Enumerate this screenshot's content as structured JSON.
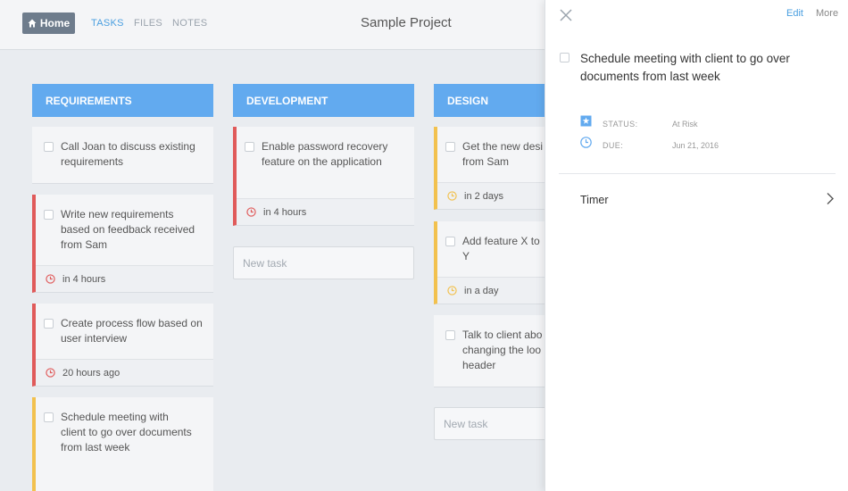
{
  "header": {
    "home_label": "Home",
    "tabs": [
      "TASKS",
      "FILES",
      "NOTES"
    ],
    "project_title": "Sample Project"
  },
  "columns": [
    {
      "title": "REQUIREMENTS",
      "cards": [
        {
          "text": "Call Joan to discuss existing requirements",
          "due": ""
        },
        {
          "text": "Write new requirements based on feedback received from Sam",
          "due": "in 4 hours"
        },
        {
          "text": "Create process flow based on user interview",
          "due": "20 hours ago"
        },
        {
          "text": "Schedule meeting with client to go over documents from last week",
          "due": ""
        }
      ]
    },
    {
      "title": "DEVELOPMENT",
      "cards": [
        {
          "text": "Enable password recovery feature on the application",
          "due": "in 4 hours"
        }
      ],
      "new_task_placeholder": "New task"
    },
    {
      "title": "DESIGN",
      "cards": [
        {
          "text": "Get the new desi from Sam",
          "due": "in 2 days"
        },
        {
          "text": "Add feature X to Y",
          "due": "in a day"
        },
        {
          "text": "Talk to client abo changing the loo header",
          "due": ""
        }
      ],
      "new_task_placeholder": "New task"
    }
  ],
  "detail_panel": {
    "edit_label": "Edit",
    "more_label": "More",
    "task_title": "Schedule meeting with client to go over documents from last week",
    "status_label": "STATUS:",
    "status_value": "At Risk",
    "due_label": "DUE:",
    "due_value": "Jun 21, 2016",
    "timer_label": "Timer"
  },
  "colors": {
    "accent": "#62aaef",
    "red": "#e05a5a",
    "yellow": "#f2c14e",
    "link": "#4a9fe0"
  }
}
